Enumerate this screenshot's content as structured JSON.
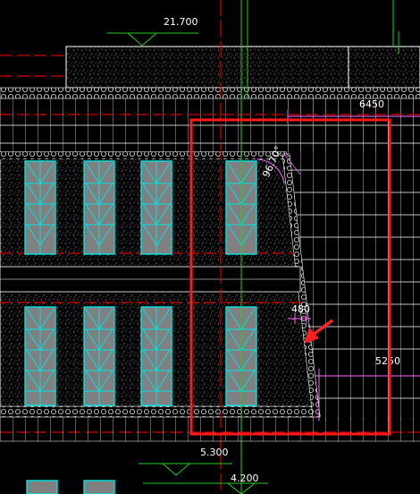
{
  "drawing": {
    "elevation_top": "21.700",
    "dim_top_right": "6450",
    "angle": "96.70°",
    "dim_small": "480",
    "dim_right": "5250",
    "elevation_mid": "5.300",
    "elevation_bottom": "4.200"
  },
  "colors": {
    "background": "#000000",
    "grid": "#ffffff",
    "guide_red": "#d40000",
    "guide_green": "#22cc22",
    "highlight_box": "#ff1a1a",
    "window": "#00e5e5",
    "window_fill": "#808080",
    "dimension": "#ff66ff"
  },
  "icons": {
    "arrow": "red-arrow-icon",
    "elevation_marker": "elevation-triangle-icon"
  }
}
